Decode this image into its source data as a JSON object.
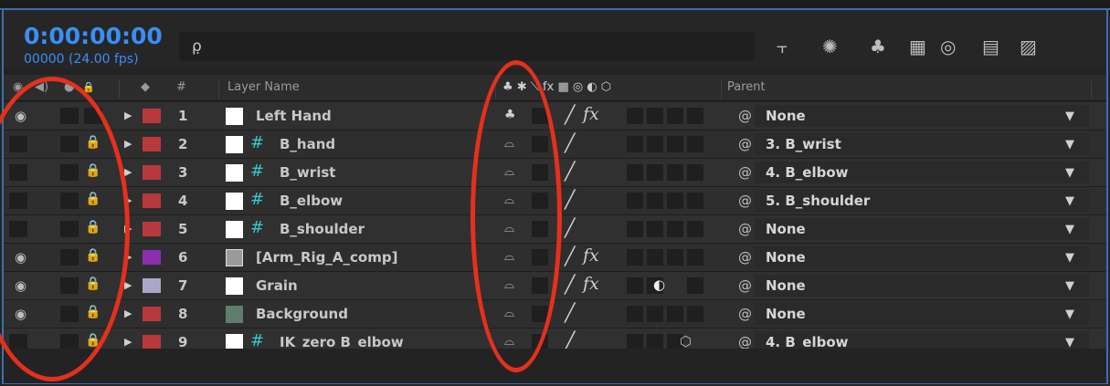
{
  "header": {
    "timecode": "0:00:00:00",
    "frames": "00000 (24.00 fps)",
    "search_icon": "ρ̣",
    "tools": [
      {
        "name": "comp-mini-flowchart-icon",
        "glyph": "⫟"
      },
      {
        "name": "draft-3d-icon",
        "glyph": "✺"
      },
      {
        "name": "shy-layers-icon",
        "glyph": "♣"
      },
      {
        "name": "frame-blending-icon",
        "glyph": "▦"
      },
      {
        "name": "motion-blur-icon",
        "glyph": "◎"
      },
      {
        "name": "graph-editor-icon",
        "glyph": "▤"
      },
      {
        "name": "chart-icon",
        "glyph": "▨"
      }
    ]
  },
  "columns": {
    "eye": "◉",
    "audio": "◀)",
    "solo": "●",
    "lock": "🔒",
    "label": "◆",
    "num": "#",
    "layer_name": "Layer Name",
    "switches": "♣ ✱ ⟍ fx ▦ ◎ ◐ ⬡",
    "parent": "Parent"
  },
  "rows": [
    {
      "num": "1",
      "name": "Left Hand",
      "eye": true,
      "lock": false,
      "label_color": "#b8393c",
      "src": "solid",
      "parent": "None",
      "fx": true,
      "shy": "♣"
    },
    {
      "num": "2",
      "name": "B_hand",
      "eye": false,
      "lock": true,
      "label_color": "#b8393c",
      "src": "null",
      "parent": "3. B_wrist",
      "fx": false,
      "shy": "⌓"
    },
    {
      "num": "3",
      "name": "B_wrist",
      "eye": false,
      "lock": true,
      "label_color": "#b8393c",
      "src": "null",
      "parent": "4. B_elbow",
      "fx": false,
      "shy": "⌓"
    },
    {
      "num": "4",
      "name": "B_elbow",
      "eye": false,
      "lock": true,
      "label_color": "#b8393c",
      "src": "null",
      "parent": "5. B_shoulder",
      "fx": false,
      "shy": "⌓"
    },
    {
      "num": "5",
      "name": "B_shoulder",
      "eye": false,
      "lock": true,
      "label_color": "#b8393c",
      "src": "null",
      "parent": "None",
      "fx": false,
      "shy": "⌓"
    },
    {
      "num": "6",
      "name": "[Arm_Rig_A_comp]",
      "eye": true,
      "lock": true,
      "label_color": "#8b2fb0",
      "src": "comp",
      "parent": "None",
      "fx": true,
      "shy": "⌓"
    },
    {
      "num": "7",
      "name": "Grain",
      "eye": true,
      "lock": true,
      "label_color": "#a9a7c9",
      "src": "solid",
      "parent": "None",
      "fx": true,
      "adj": true,
      "shy": "⌓"
    },
    {
      "num": "8",
      "name": "Background",
      "eye": true,
      "lock": true,
      "label_color": "#b8393c",
      "src": "solid-green",
      "parent": "None",
      "fx": false,
      "shy": "⌓"
    },
    {
      "num": "9",
      "name": "IK_zero B_elbow",
      "eye": false,
      "lock": true,
      "label_color": "#b8393c",
      "src": "null",
      "parent": "4. B_elbow",
      "fx": false,
      "threed": true,
      "shy": "⌓"
    }
  ],
  "symbols": {
    "eye": "◉",
    "lock": "🔒",
    "tri": "▶",
    "hash": "#",
    "slash": "╱",
    "fx": "fx",
    "adj": "◐",
    "threed": "⬡",
    "pick": "@",
    "caret": "▼"
  },
  "colors": {
    "accent": "#3a8ef5",
    "annotation": "#e4301d",
    "null_icon": "#37c8c8"
  }
}
